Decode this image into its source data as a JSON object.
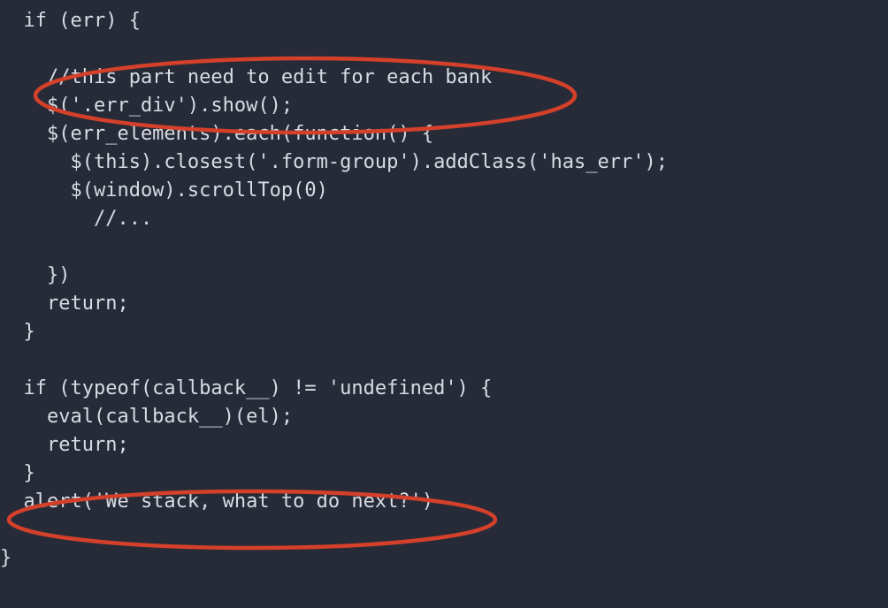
{
  "code": {
    "l0": "  if (err) {",
    "l1": "",
    "l2": "    //this part need to edit for each bank",
    "l3": "    $('.err_div').show();",
    "l4": "    $(err_elements).each(function() {",
    "l5": "      $(this).closest('.form-group').addClass('has_err');",
    "l6": "      $(window).scrollTop(0)",
    "l7": "        //...",
    "l8": "",
    "l9": "    })",
    "l10": "    return;",
    "l11": "  }",
    "l12": "",
    "l13": "  if (typeof(callback__) != 'undefined') {",
    "l14": "    eval(callback__)(el);",
    "l15": "    return;",
    "l16": "  }",
    "l17": "  alert('We stack, what to do next?')",
    "l18": "",
    "l19": "}"
  },
  "annotations": {
    "ellipse1_label": "highlight-comment-edit-for-each-bank",
    "ellipse2_label": "highlight-alert-we-stack"
  },
  "colors": {
    "background": "#272b38",
    "text": "#d7dce4",
    "annotation_stroke": "#d4402a"
  }
}
